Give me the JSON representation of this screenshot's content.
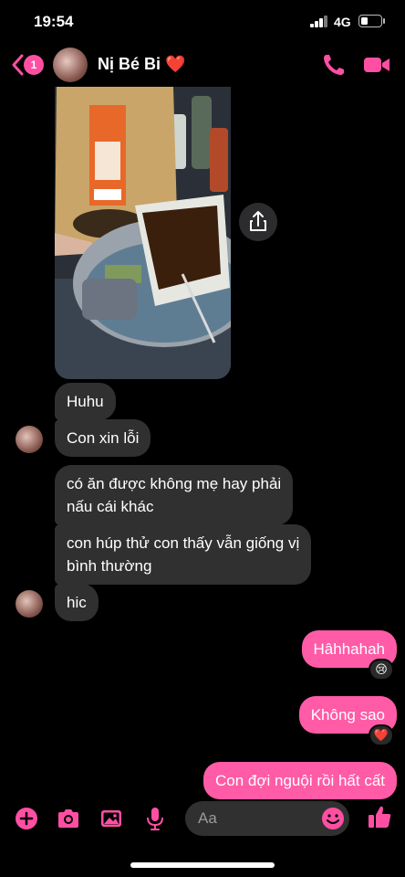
{
  "status_bar": {
    "time": "19:54",
    "network": "4G",
    "battery_level": 0.35
  },
  "header": {
    "back_badge": "1",
    "contact_name": "Nị Bé Bi ❤️"
  },
  "messages": [
    {
      "text": "Huhu",
      "side": "in"
    },
    {
      "text": "Con xin lỗi",
      "side": "in"
    },
    {
      "text_lines": [
        "có ăn được không mẹ hay phải",
        "nấu cái khác"
      ],
      "side": "in"
    },
    {
      "text_lines": [
        "con húp thử con thấy vẫn giống vị",
        "bình thường"
      ],
      "side": "in"
    },
    {
      "text": "hic",
      "side": "in"
    },
    {
      "text": "Hâhhahah",
      "side": "out",
      "reaction": "😢"
    },
    {
      "text": "Không sao",
      "side": "out",
      "reaction": "❤️"
    },
    {
      "text": "Con đợi nguội rồi hất cất",
      "side": "out"
    }
  ],
  "composer": {
    "placeholder": "Aa"
  },
  "colors": {
    "accent": "#ff5ba7",
    "incoming_bubble": "#303030",
    "background": "#000000"
  },
  "icons": [
    "chevron-left-icon",
    "phone-icon",
    "video-camera-icon",
    "share-icon",
    "plus-icon",
    "camera-icon",
    "image-icon",
    "microphone-icon",
    "emoji-icon",
    "thumbs-up-icon"
  ]
}
